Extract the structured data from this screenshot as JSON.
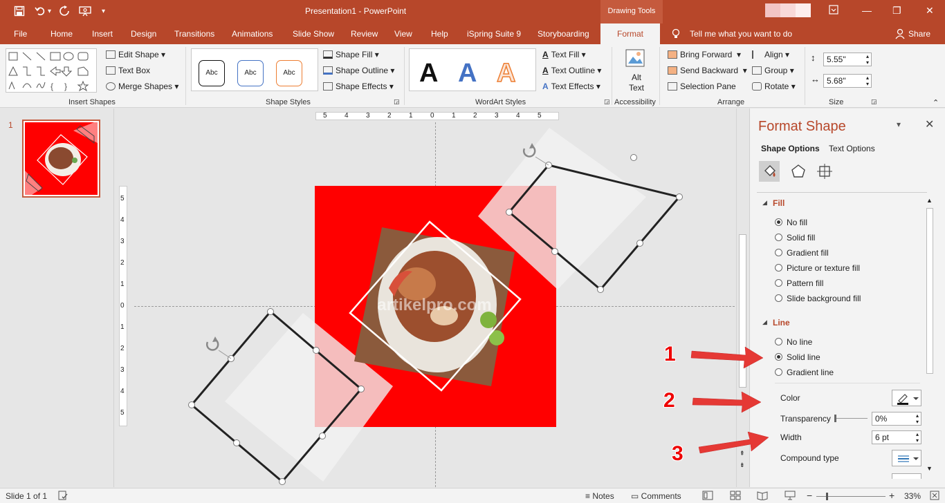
{
  "titlebar": {
    "title": "Presentation1  -  PowerPoint",
    "contextual_tab_group": "Drawing Tools",
    "quick_access": {
      "save_icon": "save-icon",
      "undo_icon": "undo-icon",
      "redo_icon": "redo-icon",
      "present_icon": "present-icon",
      "customize": "▾"
    },
    "window": {
      "restore_icon": "ribbon-display-icon",
      "minimize": "—",
      "maximize": "❐",
      "close": "✕"
    }
  },
  "tabs": [
    "File",
    "Home",
    "Insert",
    "Design",
    "Transitions",
    "Animations",
    "Slide Show",
    "Review",
    "View",
    "Help",
    "iSpring Suite 9",
    "Storyboarding",
    "Format"
  ],
  "tellme": "Tell me what you want to do",
  "share": "Share",
  "ribbon": {
    "insert_shapes": {
      "label": "Insert Shapes",
      "edit_shape": "Edit Shape",
      "text_box": "Text Box",
      "merge_shapes": "Merge Shapes"
    },
    "shape_styles": {
      "label": "Shape Styles",
      "preset": "Abc",
      "shape_fill": "Shape Fill",
      "shape_outline": "Shape Outline",
      "shape_effects": "Shape Effects"
    },
    "wordart_styles": {
      "label": "WordArt Styles",
      "letter": "A",
      "text_fill": "Text Fill",
      "text_outline": "Text Outline",
      "text_effects": "Text Effects"
    },
    "accessibility": {
      "label": "Accessibility",
      "alt_text": "Alt Text"
    },
    "arrange": {
      "label": "Arrange",
      "bring_forward": "Bring Forward",
      "send_backward": "Send Backward",
      "selection_pane": "Selection Pane",
      "align": "Align",
      "group": "Group",
      "rotate": "Rotate"
    },
    "size": {
      "label": "Size",
      "height": "5.55\"",
      "width": "5.68\""
    }
  },
  "thumbnails": {
    "slide_number": "1"
  },
  "ruler": {
    "h_ticks": [
      "5",
      "4",
      "3",
      "2",
      "1",
      "0",
      "1",
      "2",
      "3",
      "4",
      "5"
    ],
    "v_ticks": [
      "5",
      "4",
      "3",
      "2",
      "1",
      "0",
      "1",
      "2",
      "3",
      "4",
      "5"
    ]
  },
  "watermark": "artikelpro.com",
  "annotations": [
    "1",
    "2",
    "3"
  ],
  "format_pane": {
    "title": "Format Shape",
    "tab_shape_options": "Shape Options",
    "tab_text_options": "Text Options",
    "fill_section": "Fill",
    "fill_options": [
      "No fill",
      "Solid fill",
      "Gradient fill",
      "Picture or texture fill",
      "Pattern fill",
      "Slide background fill"
    ],
    "fill_selected": 0,
    "line_section": "Line",
    "line_options": [
      "No line",
      "Solid line",
      "Gradient line"
    ],
    "line_selected": 1,
    "color_label": "Color",
    "transparency_label": "Transparency",
    "transparency_value": "0%",
    "width_label": "Width",
    "width_value": "6 pt",
    "compound_label": "Compound type"
  },
  "status": {
    "slide_info": "Slide 1 of 1",
    "notes": "Notes",
    "comments": "Comments",
    "zoom": "33%"
  },
  "colors": {
    "accent": "#b7472a",
    "slide_red": "#ff0000",
    "arrow_red": "#e53935"
  }
}
